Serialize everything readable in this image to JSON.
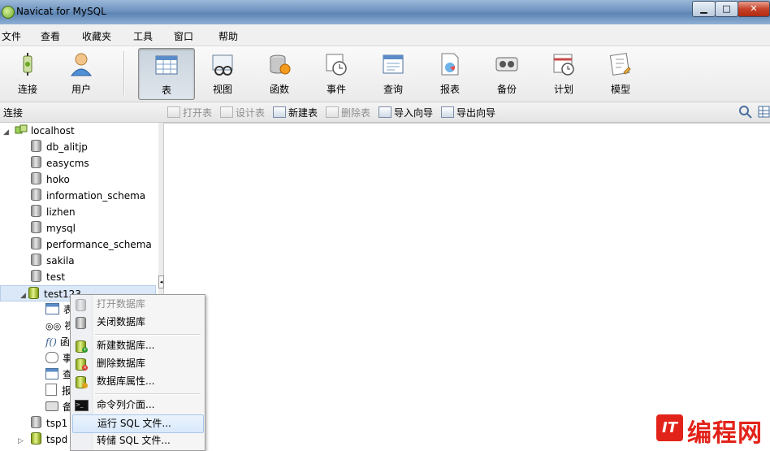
{
  "window": {
    "title": "Navicat for MySQL",
    "min": "▁",
    "max": "□",
    "close": "✕"
  },
  "menu": [
    "文件",
    "查看",
    "收藏夹",
    "工具",
    "窗口",
    "帮助"
  ],
  "toolbar": [
    {
      "label": "连接",
      "icon": "connection-icon"
    },
    {
      "label": "用户",
      "icon": "user-icon"
    },
    {
      "label": "表",
      "icon": "table-icon",
      "active": true
    },
    {
      "label": "视图",
      "icon": "view-icon"
    },
    {
      "label": "函数",
      "icon": "function-icon"
    },
    {
      "label": "事件",
      "icon": "event-icon"
    },
    {
      "label": "查询",
      "icon": "query-icon"
    },
    {
      "label": "报表",
      "icon": "report-icon"
    },
    {
      "label": "备份",
      "icon": "backup-icon"
    },
    {
      "label": "计划",
      "icon": "schedule-icon"
    },
    {
      "label": "模型",
      "icon": "model-icon"
    }
  ],
  "panel_label": "连接",
  "object_toolbar": [
    {
      "label": "打开表",
      "enabled": false
    },
    {
      "label": "设计表",
      "enabled": false
    },
    {
      "label": "新建表",
      "enabled": true
    },
    {
      "label": "删除表",
      "enabled": false
    },
    {
      "label": "导入向导",
      "enabled": true
    },
    {
      "label": "导出向导",
      "enabled": true
    }
  ],
  "tree": {
    "connection": "localhost",
    "databases": [
      "db_alitjp",
      "easycms",
      "hoko",
      "information_schema",
      "lizhen",
      "mysql",
      "performance_schema",
      "sakila",
      "test",
      "test123"
    ],
    "children_glyphs": [
      "表",
      "视",
      "函",
      "事",
      "查",
      "报",
      "备"
    ],
    "after": [
      "tsp1",
      "tspd"
    ]
  },
  "context_menu": [
    {
      "label": "打开数据库",
      "enabled": false
    },
    {
      "label": "关闭数据库",
      "enabled": true
    },
    {
      "label": "新建数据库...",
      "enabled": true
    },
    {
      "label": "删除数据库",
      "enabled": true
    },
    {
      "label": "数据库属性...",
      "enabled": true
    },
    {
      "label": "命令列介面...",
      "enabled": true
    },
    {
      "label": "运行 SQL 文件...",
      "enabled": true,
      "highlighted": true
    },
    {
      "label": "转储 SQL 文件...",
      "enabled": true
    }
  ],
  "watermark": {
    "logo": "IT",
    "text": "编程网"
  },
  "colors": {
    "accent": "#e2231a",
    "selection": "#d9e9fb"
  }
}
